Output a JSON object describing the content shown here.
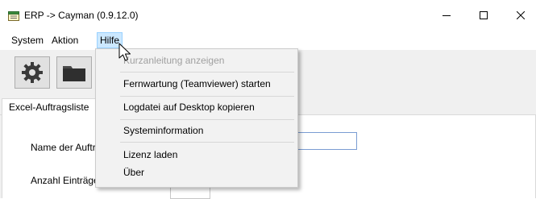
{
  "window": {
    "title": "ERP -> Cayman (0.9.12.0)",
    "icons": {
      "app": "app-window-icon",
      "minimize": "minimize-icon",
      "maximize": "maximize-icon",
      "close": "close-icon"
    }
  },
  "menubar": {
    "items": [
      {
        "label": "System"
      },
      {
        "label": "Aktion"
      },
      {
        "label": "Hilfe",
        "open": true
      }
    ]
  },
  "toolbar": {
    "buttons": [
      {
        "icon": "gear-icon"
      },
      {
        "icon": "folder-icon"
      }
    ]
  },
  "tabs": [
    {
      "label": "Excel-Auftragsliste"
    }
  ],
  "form": {
    "name_label": "Name der Auftragsliste:",
    "count_label": "Anzahl Einträge in Auftrag:"
  },
  "help_menu": {
    "items": [
      {
        "label": "Kurzanleitung anzeigen",
        "enabled": false
      },
      {
        "label": "Fernwartung (Teamviewer) starten",
        "enabled": true
      },
      {
        "label": "Logdatei auf Desktop kopieren",
        "enabled": true
      },
      {
        "label": "Systeminformation",
        "enabled": true
      },
      {
        "label": "Lizenz laden",
        "enabled": true
      },
      {
        "label": "Über",
        "enabled": true
      }
    ]
  },
  "colors": {
    "menu_highlight": "#cce8ff",
    "menu_highlight_border": "#99d1ff",
    "disabled_text": "#a0a0a0",
    "textbox_focus_border": "#7a9cd3"
  }
}
